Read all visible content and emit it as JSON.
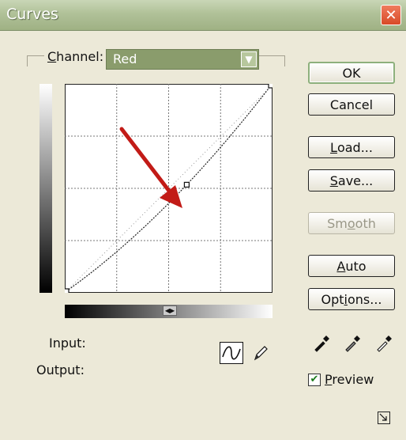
{
  "window": {
    "title": "Curves",
    "close_glyph": "✕"
  },
  "channel": {
    "label_prefix": "C",
    "label_rest": "hannel:",
    "value": "Red"
  },
  "curve": {
    "points": [
      [
        0,
        0
      ],
      [
        150,
        132
      ],
      [
        255,
        255
      ]
    ]
  },
  "buttons": {
    "ok": "OK",
    "cancel": "Cancel",
    "load_u": "L",
    "load_rest": "oad...",
    "save_u": "S",
    "save_rest": "ave...",
    "smooth_pre": "Sm",
    "smooth_u": "o",
    "smooth_rest": "oth",
    "auto_u": "A",
    "auto_rest": "uto",
    "options_pre": "Opt",
    "options_u": "i",
    "options_rest": "ons..."
  },
  "io": {
    "input_label": "Input:",
    "output_label": "Output:"
  },
  "preview": {
    "label_u": "P",
    "label_rest": "review",
    "checked": true
  }
}
